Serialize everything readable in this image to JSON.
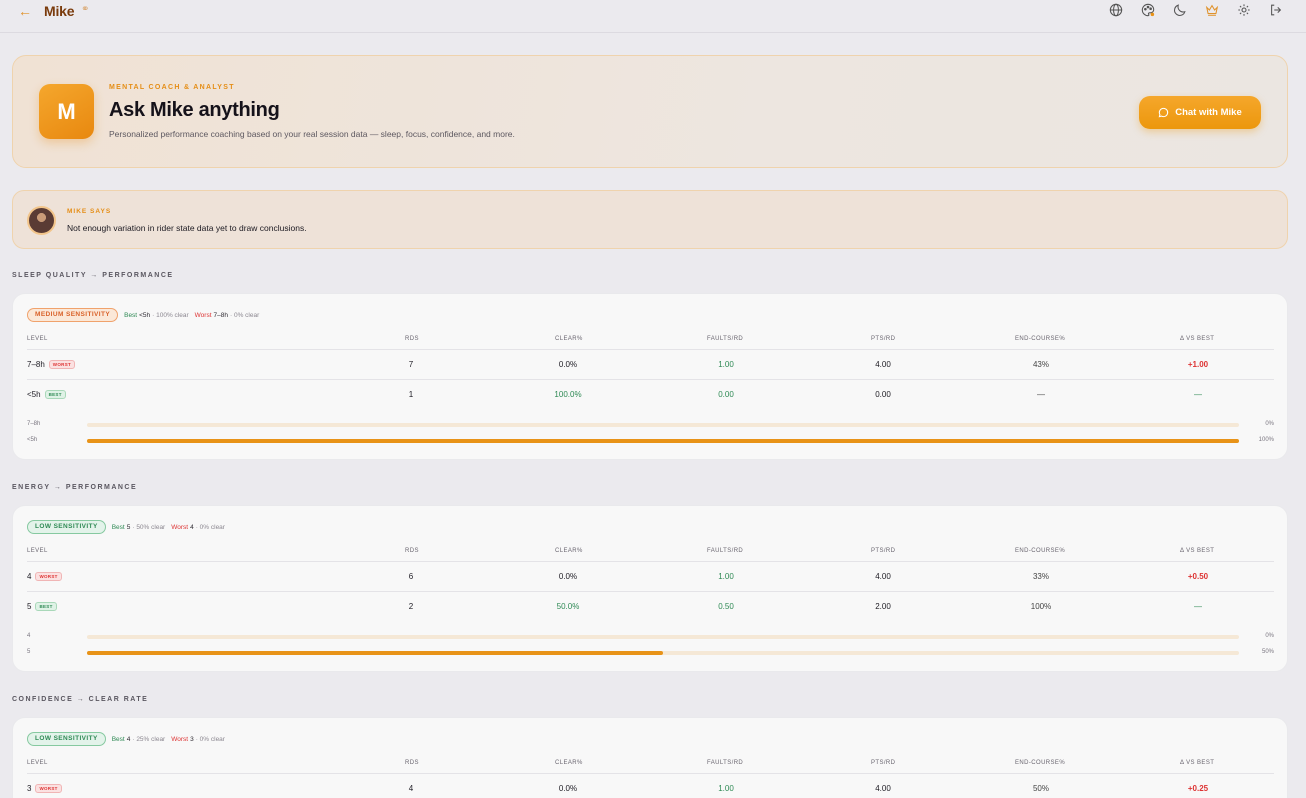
{
  "header": {
    "back_icon": "arrow-left-icon",
    "title": "Mike",
    "title_icon": "headphones-icon",
    "icons": [
      "globe-icon",
      "palette-icon",
      "moon-icon",
      "crown-icon",
      "gear-icon",
      "logout-icon"
    ]
  },
  "hero": {
    "avatar_letter": "M",
    "kicker": "MENTAL COACH & ANALYST",
    "title": "Ask Mike anything",
    "subtitle": "Personalized performance coaching based on your real session data — sleep, focus, confidence, and more.",
    "button_label": "Chat with Mike",
    "button_icon": "chat-bubble-icon",
    "accent": "#ef9a18"
  },
  "says": {
    "kicker": "MIKE SAYS",
    "text": "Not enough variation in rider state data yet to draw conclusions."
  },
  "columns": [
    "LEVEL",
    "RDS",
    "CLEAR%",
    "FAULTS/RD",
    "PTS/RD",
    "END-COURSE%",
    "Δ VS BEST"
  ],
  "colors": {
    "best": "#2f8a55",
    "worst": "#dd3333",
    "bar": "#e89318"
  },
  "sections": [
    {
      "title": "SLEEP QUALITY → PERFORMANCE",
      "sensitivity": "MEDIUM SENSITIVITY",
      "best_label": "Best",
      "best_key": "<5h",
      "best_detail": "· 100% clear",
      "worst_label": "Worst",
      "worst_key": "7–8h",
      "worst_detail": "· 0% clear",
      "rows": [
        {
          "level": "7–8h",
          "tag": "WORST",
          "rds": "7",
          "clear": "0.0%",
          "faults": "1.00",
          "pts": "4.00",
          "end": "43%",
          "delta": "+1.00"
        },
        {
          "level": "<5h",
          "tag": "BEST",
          "rds": "1",
          "clear": "100.0%",
          "faults": "0.00",
          "pts": "0.00",
          "end": "—",
          "delta": "—"
        }
      ],
      "bars": [
        {
          "label": "7–8h",
          "value": 0,
          "pct": "0%"
        },
        {
          "label": "<5h",
          "value": 1.0,
          "pct": "100%"
        }
      ]
    },
    {
      "title": "ENERGY → PERFORMANCE",
      "sensitivity": "LOW SENSITIVITY",
      "best_label": "Best",
      "best_key": "5",
      "best_detail": "· 50% clear",
      "worst_label": "Worst",
      "worst_key": "4",
      "worst_detail": "· 0% clear",
      "rows": [
        {
          "level": "4",
          "tag": "WORST",
          "rds": "6",
          "clear": "0.0%",
          "faults": "1.00",
          "pts": "4.00",
          "end": "33%",
          "delta": "+0.50"
        },
        {
          "level": "5",
          "tag": "BEST",
          "rds": "2",
          "clear": "50.0%",
          "faults": "0.50",
          "pts": "2.00",
          "end": "100%",
          "delta": "—"
        }
      ],
      "bars": [
        {
          "label": "4",
          "value": 0,
          "pct": "0%"
        },
        {
          "label": "5",
          "value": 0.5,
          "pct": "50%"
        }
      ]
    },
    {
      "title": "CONFIDENCE → CLEAR RATE",
      "sensitivity": "LOW SENSITIVITY",
      "best_label": "Best",
      "best_key": "4",
      "best_detail": "· 25% clear",
      "worst_label": "Worst",
      "worst_key": "3",
      "worst_detail": "· 0% clear",
      "rows": [
        {
          "level": "3",
          "tag": "WORST",
          "rds": "4",
          "clear": "0.0%",
          "faults": "1.00",
          "pts": "4.00",
          "end": "50%",
          "delta": "+0.25"
        }
      ],
      "bars": []
    }
  ]
}
